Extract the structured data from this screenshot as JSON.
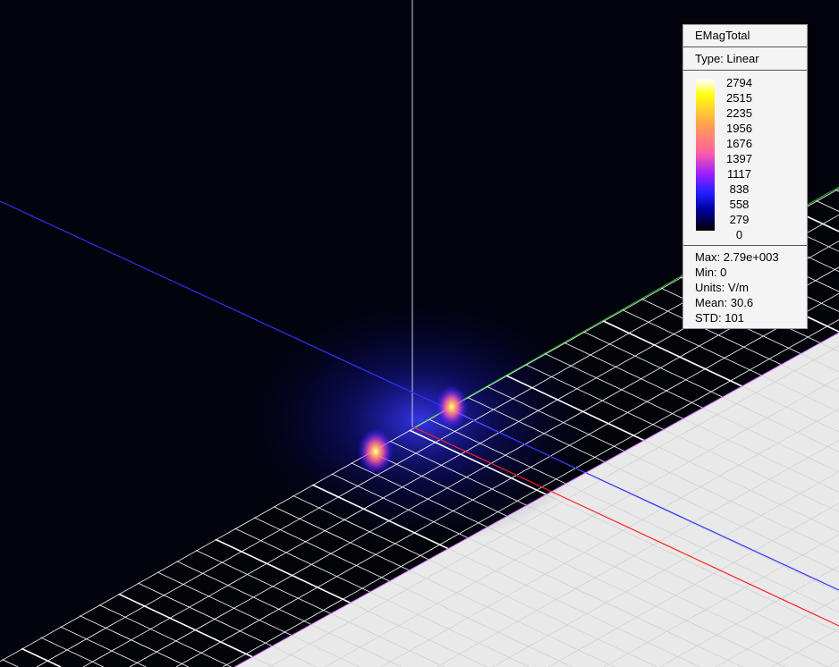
{
  "legend": {
    "title": "EMagTotal",
    "type": "Type: Linear",
    "ticks": [
      "2794",
      "2515",
      "2235",
      "1956",
      "1676",
      "1397",
      "1117",
      "838",
      "558",
      "279",
      "0"
    ],
    "stats": {
      "max": "Max: 2.79e+003",
      "min": "Min: 0",
      "units": "Units: V/m",
      "mean": "Mean: 30.6",
      "std": "STD: 101"
    }
  },
  "colors": {
    "background": "#02030c",
    "ground_plane": "#e8e8e8",
    "x_axis": "#ff2020",
    "y_axis": "#20c020",
    "z_axis_line": "#3030ff"
  }
}
